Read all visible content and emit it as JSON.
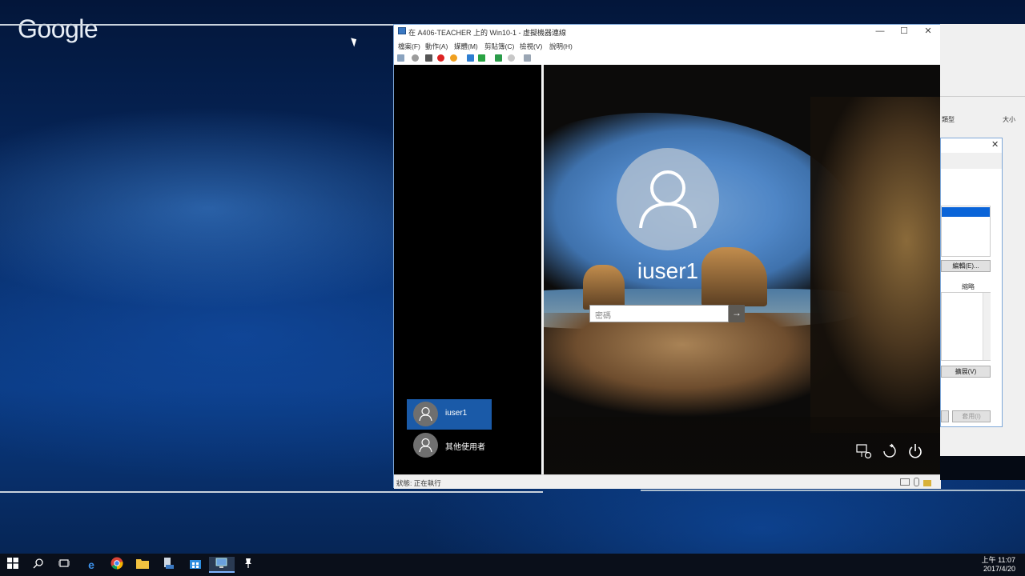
{
  "desktop": {
    "logo_text": "Google"
  },
  "vm_window": {
    "title": "在 A406-TEACHER 上的 Win10-1 - 虛擬機器連線",
    "menu": [
      "檔案(F)",
      "動作(A)",
      "媒體(M)",
      "剪貼簿(C)",
      "檢視(V)",
      "說明(H)"
    ],
    "window_buttons": {
      "minimize": "—",
      "maximize": "☐",
      "close": "✕"
    },
    "status_text": "狀態: 正在執行"
  },
  "login": {
    "username": "iuser1",
    "password_placeholder": "密碼",
    "submit_glyph": "→",
    "users": [
      {
        "label": "iuser1",
        "selected": true
      },
      {
        "label": "其他使用者",
        "selected": false
      }
    ],
    "system_icons": [
      "network-icon",
      "ease-of-access-icon",
      "power-icon"
    ]
  },
  "side_dialog": {
    "header_type": "類型",
    "header_size": "大小",
    "close": "✕",
    "edit_button": "編輯(E)...",
    "label_shrink": "縮略",
    "expand_button": "擴展(V)",
    "apply_button": "套用(I)"
  },
  "taskbar": {
    "start_icon": "windows-start-icon",
    "time": "上午 11:07",
    "date": "2017/4/20"
  },
  "colors": {
    "selection_blue": "#1a5aa8",
    "taskbar": "#0a0f1a"
  }
}
